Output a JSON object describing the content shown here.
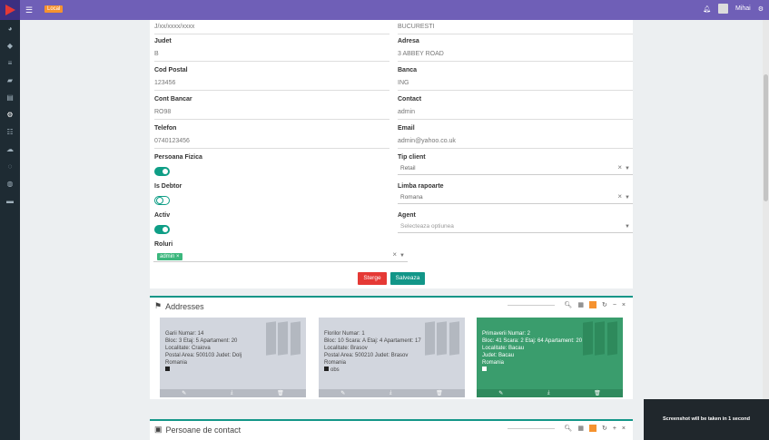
{
  "topbar": {
    "badge": "Local",
    "user": "Mihai"
  },
  "form": {
    "left": [
      {
        "value": "J/xx/xxxx/xxxx"
      },
      {
        "label": "Judet",
        "value": "B"
      },
      {
        "label": "Cod Postal",
        "value": "123456"
      },
      {
        "label": "Cont Bancar",
        "value": "RO98"
      },
      {
        "label": "Telefon",
        "value": "0740123456"
      }
    ],
    "right": [
      {
        "value": "BUCURESTI"
      },
      {
        "label": "Adresa",
        "value": "3 ABBEY ROAD"
      },
      {
        "label": "Banca",
        "value": "ING"
      },
      {
        "label": "Contact",
        "value": "admin"
      },
      {
        "label": "Email",
        "value": "admin@yahoo.co.uk"
      }
    ],
    "persoana_fizica": "Persoana Fizica",
    "is_debtor": "Is Debtor",
    "activ": "Activ",
    "roluri": "Roluri",
    "role_chip": "admin",
    "tip_client": {
      "label": "Tip client",
      "value": "Retail"
    },
    "limba": {
      "label": "Limba rapoarte",
      "value": "Romana"
    },
    "agent": {
      "label": "Agent",
      "placeholder": "Selecteaza optiunea"
    },
    "delete_label": "Sterge",
    "save_label": "Salveaza"
  },
  "addresses": {
    "title": "Addresses",
    "cards": [
      {
        "l1": "Garii Numar: 14",
        "l2": "Bloc: 3 Etaj: 5 Apartament: 20",
        "l3": "Localitate: Craiova",
        "l4": "Postal Area: 500103 Judet: Dolj",
        "l5": "Romania",
        "l6": ""
      },
      {
        "l1": "Florilor Numar: 1",
        "l2": "Bloc: 10 Scara: A Etaj: 4 Apartament: 17",
        "l3": "Localitate: Brasov",
        "l4": "Postal Area: 500210 Judet: Brasov",
        "l5": "Romania",
        "l6": "obs"
      },
      {
        "l1": "Primaverii Numar: 2",
        "l2": "Bloc: 41 Scara: 2 Etaj: 64 Apartament: 20",
        "l3": "Localitate: Bacau",
        "l4": "Judet: Bacau",
        "l5": "Romania",
        "l6": ""
      }
    ]
  },
  "contacts": {
    "title": "Persoane de contact"
  },
  "toast": "Screenshot will be taken in 1 second"
}
